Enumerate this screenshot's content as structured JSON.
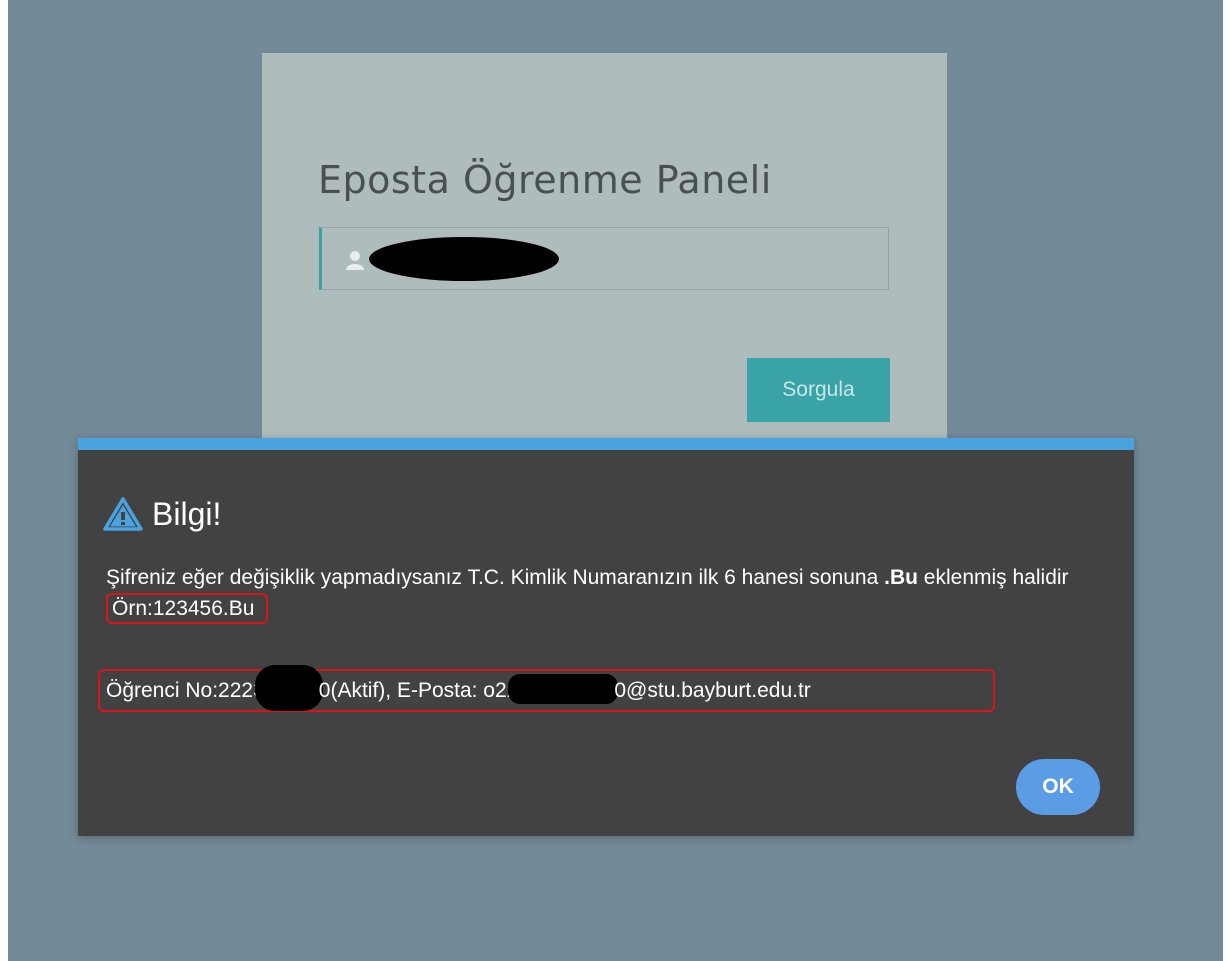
{
  "panel": {
    "title": "Eposta Öğrenme Paneli",
    "input_value": "",
    "submit_label": "Sorgula"
  },
  "dialog": {
    "title": "Bilgi!",
    "message_part1": "Şifreniz eğer değişiklik yapmadıysanız T.C. Kimlik Numaranızın ilk 6 hanesi sonuna ",
    "message_bold": ".Bu",
    "message_part2": " eklenmiş halidir ",
    "message_example": "Örn:123456.Bu",
    "info_student_prefix": "Öğrenci No:2223",
    "info_student_suffix": "0(Aktif), E-Posta: o22",
    "info_email_suffix": "0@stu.bayburt.edu.tr",
    "ok_label": "OK"
  },
  "colors": {
    "page_background": "#738a98",
    "panel_background": "#aebcbc",
    "accent_teal": "#3aa3a8",
    "dialog_background": "#424242",
    "dialog_top_bar": "#4aa3df",
    "ok_button": "#5b9de5",
    "highlight_red": "#d9141b"
  },
  "icons": {
    "input_icon": "user-icon",
    "dialog_icon": "warning-icon"
  }
}
